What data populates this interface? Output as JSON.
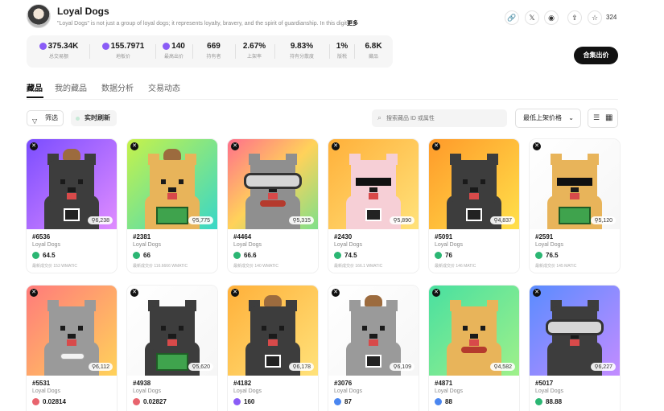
{
  "collection": {
    "title": "Loyal Dogs",
    "description": "\"Loyal Dogs\" is not just a group of loyal dogs; it represents loyalty, bravery, and the spirit of guardianship. In this digit",
    "more_label": "更多",
    "star_count": "324",
    "icons": [
      "link-icon",
      "x-icon",
      "discord-icon",
      "share-icon",
      "star-icon"
    ]
  },
  "stats": [
    {
      "value": "375.34K",
      "label": "总交易额",
      "coin": true
    },
    {
      "value": "155.7971",
      "label": "地板价",
      "coin": true
    },
    {
      "value": "140",
      "label": "最高出价",
      "coin": true
    },
    {
      "value": "669",
      "label": "持有者",
      "coin": false
    },
    {
      "value": "2.67%",
      "label": "上架率",
      "coin": false
    },
    {
      "value": "9.83%",
      "label": "持有分散度",
      "coin": false
    },
    {
      "value": "1%",
      "label": "版税",
      "coin": false
    },
    {
      "value": "6.8K",
      "label": "藏品",
      "coin": false
    }
  ],
  "offer_button": "合集出价",
  "tabs": [
    "藏品",
    "我的藏品",
    "数据分析",
    "交易动态"
  ],
  "toolbar": {
    "filter_label": "筛选",
    "live_label": "实时刷新",
    "search_placeholder": "搜索藏品 ID 或属性",
    "sort_label": "最低上架价格"
  },
  "cards": [
    {
      "name": "#6536",
      "collection": "Loyal Dogs",
      "price": "64.5",
      "last": "最新成交价 153 WMATIC",
      "rarity": "6,238",
      "bg": "linear-gradient(135deg,#7b4dff,#e08cff)",
      "fur": "#3d3d3d",
      "prop": "camera",
      "hat": true,
      "goggles": false,
      "sunglasses": false,
      "price_color": "#2bb673"
    },
    {
      "name": "#2381",
      "collection": "Loyal Dogs",
      "price": "66",
      "last": "最新成交价 116.6666 WMATIC",
      "rarity": "5,775",
      "bg": "linear-gradient(135deg,#c6f24a,#38d7c8)",
      "fur": "#e8b45a",
      "prop": "book",
      "hat": true,
      "goggles": false,
      "sunglasses": false,
      "price_color": "#2bb673"
    },
    {
      "name": "#4464",
      "collection": "Loyal Dogs",
      "price": "66.6",
      "last": "最新成交价 140 WMATIC",
      "rarity": "5,315",
      "bg": "linear-gradient(135deg,#ff6f8c,#ffd25a,#7ee08a)",
      "fur": "#8f8f8f",
      "prop": "sausage",
      "hat": false,
      "goggles": true,
      "sunglasses": false,
      "price_color": "#2bb673"
    },
    {
      "name": "#2430",
      "collection": "Loyal Dogs",
      "price": "74.5",
      "last": "最新成交价 166.1 WMATIC",
      "rarity": "5,890",
      "bg": "linear-gradient(135deg,#ffb03a,#ffe27a)",
      "fur": "#f6cfd6",
      "prop": "camera",
      "hat": false,
      "goggles": false,
      "sunglasses": true,
      "price_color": "#2bb673"
    },
    {
      "name": "#5091",
      "collection": "Loyal Dogs",
      "price": "76",
      "last": "最新成交价 146 MATIC",
      "rarity": "4,837",
      "bg": "linear-gradient(135deg,#ff9a2a,#ffe04a)",
      "fur": "#3d3d3d",
      "prop": "camera",
      "hat": false,
      "goggles": false,
      "sunglasses": false,
      "price_color": "#2bb673"
    },
    {
      "name": "#2591",
      "collection": "Loyal Dogs",
      "price": "76.5",
      "last": "最新成交价 145 MATIC",
      "rarity": "5,120",
      "bg": "linear-gradient(135deg,#ffffff,#f6f6f6)",
      "fur": "#e8b45a",
      "prop": "book",
      "hat": false,
      "goggles": false,
      "sunglasses": true,
      "price_color": "#2bb673"
    },
    {
      "name": "#5531",
      "collection": "Loyal Dogs",
      "price": "0.02814",
      "last": "",
      "rarity": "6,112",
      "bg": "linear-gradient(135deg,#ff7b7b,#ffd25a)",
      "fur": "#9a9a9a",
      "prop": "bone",
      "hat": false,
      "goggles": false,
      "sunglasses": false,
      "price_color": "#e8646e"
    },
    {
      "name": "#4938",
      "collection": "Loyal Dogs",
      "price": "0.02827",
      "last": "",
      "rarity": "5,620",
      "bg": "linear-gradient(135deg,#ffffff,#f6f6f6)",
      "fur": "#3d3d3d",
      "prop": "book",
      "hat": false,
      "goggles": false,
      "sunglasses": false,
      "price_color": "#e8646e"
    },
    {
      "name": "#4182",
      "collection": "Loyal Dogs",
      "price": "160",
      "last": "",
      "rarity": "6,178",
      "bg": "linear-gradient(135deg,#ffb03a,#ffe27a)",
      "fur": "#3d3d3d",
      "prop": "camera",
      "hat": true,
      "goggles": false,
      "sunglasses": false,
      "price_color": "#8a5cf6"
    },
    {
      "name": "#3076",
      "collection": "Loyal Dogs",
      "price": "87",
      "last": "",
      "rarity": "6,109",
      "bg": "linear-gradient(135deg,#ffffff,#f6f6f6)",
      "fur": "#9a9a9a",
      "prop": "camera",
      "hat": true,
      "goggles": false,
      "sunglasses": false,
      "price_color": "#4a86f0"
    },
    {
      "name": "#4871",
      "collection": "Loyal Dogs",
      "price": "88",
      "last": "",
      "rarity": "4,582",
      "bg": "linear-gradient(135deg,#49e0a0,#9ff08a)",
      "fur": "#e8b45a",
      "prop": "sausage",
      "hat": false,
      "goggles": false,
      "sunglasses": false,
      "price_color": "#4a86f0"
    },
    {
      "name": "#5017",
      "collection": "Loyal Dogs",
      "price": "88.88",
      "last": "",
      "rarity": "6,227",
      "bg": "linear-gradient(135deg,#5a8cff,#c38cff)",
      "fur": "#3d3d3d",
      "prop": "none",
      "hat": false,
      "goggles": true,
      "sunglasses": false,
      "price_color": "#2bb673"
    }
  ]
}
